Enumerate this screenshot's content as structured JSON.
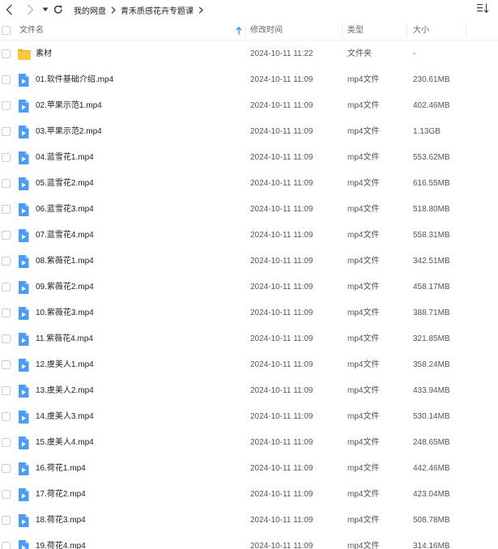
{
  "nav": {
    "back_icon": "back-arrow-icon",
    "forward_icon": "forward-arrow-icon",
    "history_icon": "dropdown-triangle-icon",
    "refresh_icon": "refresh-icon",
    "breadcrumbs": [
      "我的网盘",
      "青禾质感花卉专题课"
    ],
    "sort_icon": "sort-list-icon"
  },
  "columns": {
    "name": "文件名",
    "modified": "修改时间",
    "type": "类型",
    "size": "大小"
  },
  "files": [
    {
      "name": "素材",
      "time": "2024-10-11 11:22",
      "type": "文件夹",
      "size": "-",
      "icon": "folder"
    },
    {
      "name": "01.软件基础介绍.mp4",
      "time": "2024-10-11 11:09",
      "type": "mp4文件",
      "size": "230.61MB",
      "icon": "video"
    },
    {
      "name": "02.苹果示范1.mp4",
      "time": "2024-10-11 11:09",
      "type": "mp4文件",
      "size": "402.46MB",
      "icon": "video"
    },
    {
      "name": "03.苹果示范2.mp4",
      "time": "2024-10-11 11:09",
      "type": "mp4文件",
      "size": "1.13GB",
      "icon": "video"
    },
    {
      "name": "04.蓝雪花1.mp4",
      "time": "2024-10-11 11:09",
      "type": "mp4文件",
      "size": "553.62MB",
      "icon": "video"
    },
    {
      "name": "05.蓝雪花2.mp4",
      "time": "2024-10-11 11:09",
      "type": "mp4文件",
      "size": "616.55MB",
      "icon": "video"
    },
    {
      "name": "06.蓝雪花3.mp4",
      "time": "2024-10-11 11:09",
      "type": "mp4文件",
      "size": "518.80MB",
      "icon": "video"
    },
    {
      "name": "07.蓝雪花4.mp4",
      "time": "2024-10-11 11:09",
      "type": "mp4文件",
      "size": "558.31MB",
      "icon": "video"
    },
    {
      "name": "08.紫薇花1.mp4",
      "time": "2024-10-11 11:09",
      "type": "mp4文件",
      "size": "342.51MB",
      "icon": "video"
    },
    {
      "name": "09.紫薇花2.mp4",
      "time": "2024-10-11 11:09",
      "type": "mp4文件",
      "size": "458.17MB",
      "icon": "video"
    },
    {
      "name": "10.紫薇花3.mp4",
      "time": "2024-10-11 11:09",
      "type": "mp4文件",
      "size": "388.71MB",
      "icon": "video"
    },
    {
      "name": "11.紫薇花4.mp4",
      "time": "2024-10-11 11:09",
      "type": "mp4文件",
      "size": "321.85MB",
      "icon": "video"
    },
    {
      "name": "12.虞美人1.mp4",
      "time": "2024-10-11 11:09",
      "type": "mp4文件",
      "size": "358.24MB",
      "icon": "video"
    },
    {
      "name": "13.虞美人2.mp4",
      "time": "2024-10-11 11:09",
      "type": "mp4文件",
      "size": "433.94MB",
      "icon": "video"
    },
    {
      "name": "14.虞美人3.mp4",
      "time": "2024-10-11 11:09",
      "type": "mp4文件",
      "size": "530.14MB",
      "icon": "video"
    },
    {
      "name": "15.虞美人4.mp4",
      "time": "2024-10-11 11:09",
      "type": "mp4文件",
      "size": "248.65MB",
      "icon": "video"
    },
    {
      "name": "16.荷花1.mp4",
      "time": "2024-10-11 11:09",
      "type": "mp4文件",
      "size": "442.46MB",
      "icon": "video"
    },
    {
      "name": "17.荷花2.mp4",
      "time": "2024-10-11 11:09",
      "type": "mp4文件",
      "size": "423.04MB",
      "icon": "video"
    },
    {
      "name": "18.荷花3.mp4",
      "time": "2024-10-11 11:09",
      "type": "mp4文件",
      "size": "508.78MB",
      "icon": "video"
    },
    {
      "name": "19.荷花4.mp4",
      "time": "2024-10-11 11:09",
      "type": "mp4文件",
      "size": "314.16MB",
      "icon": "video"
    }
  ],
  "colors": {
    "folder": "#f8c93f",
    "folder_dark": "#f2b624",
    "video": "#4a9df7",
    "sort_arrow": "#2d8cf0"
  }
}
